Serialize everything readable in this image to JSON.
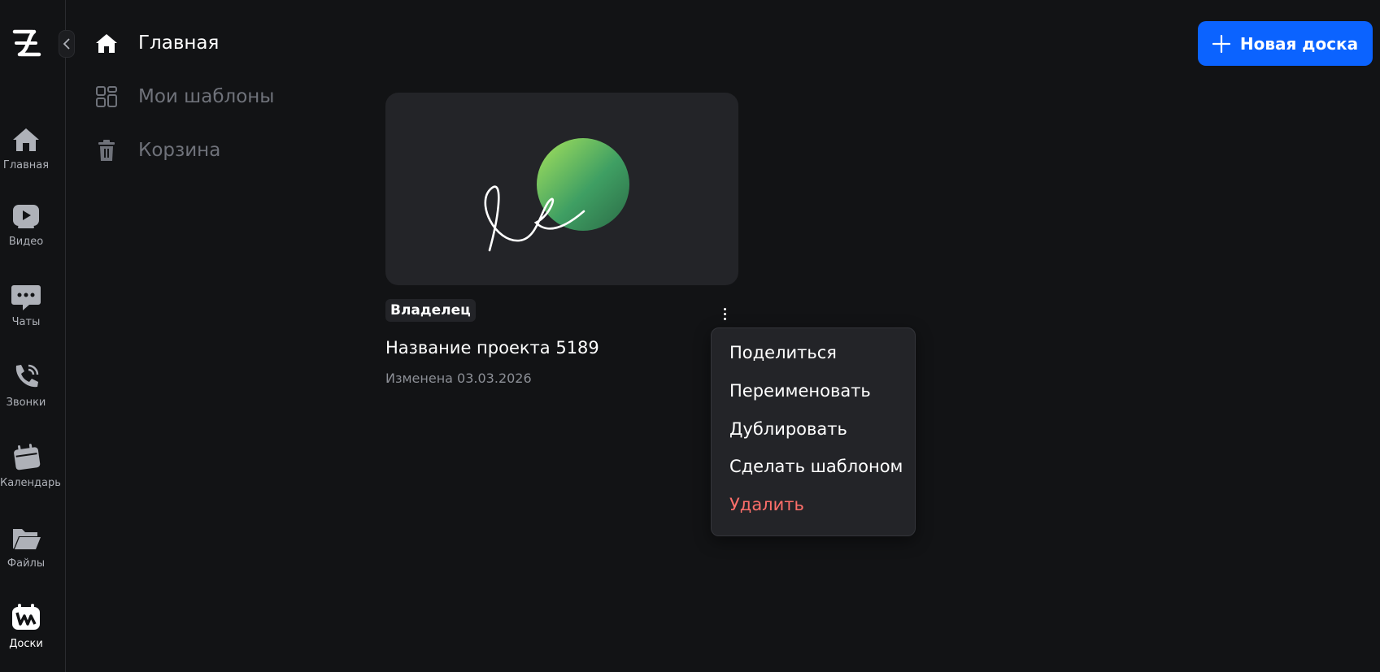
{
  "rail": {
    "items": [
      {
        "label": "Главная",
        "icon": "home-icon"
      },
      {
        "label": "Видео",
        "icon": "video-icon"
      },
      {
        "label": "Чаты",
        "icon": "chat-icon"
      },
      {
        "label": "Звонки",
        "icon": "phone-icon"
      },
      {
        "label": "Календарь",
        "icon": "calendar-icon"
      },
      {
        "label": "Файлы",
        "icon": "folder-icon"
      },
      {
        "label": "Доски",
        "icon": "boards-icon"
      }
    ],
    "active": "Доски"
  },
  "nav": {
    "items": [
      {
        "label": "Главная",
        "icon": "home-icon"
      },
      {
        "label": "Мои шаблоны",
        "icon": "grid-icon"
      },
      {
        "label": "Корзина",
        "icon": "trash-icon"
      }
    ],
    "active": "Главная"
  },
  "toolbar": {
    "new_board_label": "Новая доска"
  },
  "board": {
    "role": "Владелец",
    "title": "Название проекта 5189",
    "modified": "Изменена 03.03.2026"
  },
  "context_menu": {
    "items": [
      {
        "label": "Поделиться"
      },
      {
        "label": "Переименовать"
      },
      {
        "label": "Дублировать"
      },
      {
        "label": "Сделать шаблоном"
      },
      {
        "label": "Удалить",
        "danger": true
      }
    ]
  },
  "colors": {
    "background": "#121315",
    "card": "#232428",
    "accent": "#0b63ff",
    "danger": "#ff6f6a",
    "muted": "#6f727a"
  }
}
